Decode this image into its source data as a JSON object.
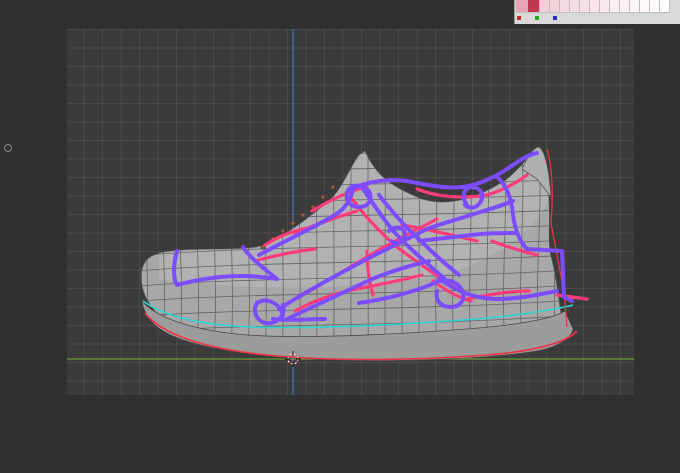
{
  "palette": {
    "swatches": [
      "#e6a3b4",
      "#c0384f",
      "#f2d1d8",
      "#f3d4db",
      "#f5dbe1",
      "#f6dde3",
      "#f7e0e5",
      "#f8e4e9",
      "#f9e8ec",
      "#fbeef1",
      "#fcf2f4",
      "#fdf5f7",
      "#fef8f9",
      "#fffafb",
      "#fffcfd"
    ],
    "channels": [
      "#cc2a2a",
      "#22a822",
      "#2233cc"
    ]
  },
  "viewport": {
    "axis_x_color": "#7ab33a",
    "axis_y_color": "#4b7fd6",
    "mesh_color": "#bcbcbc",
    "sole_outline_color": "#ee3344",
    "sole_trim_color": "#30d2d2",
    "sketch_pink": "#ff3b78",
    "sketch_purple": "#7b4dff"
  }
}
